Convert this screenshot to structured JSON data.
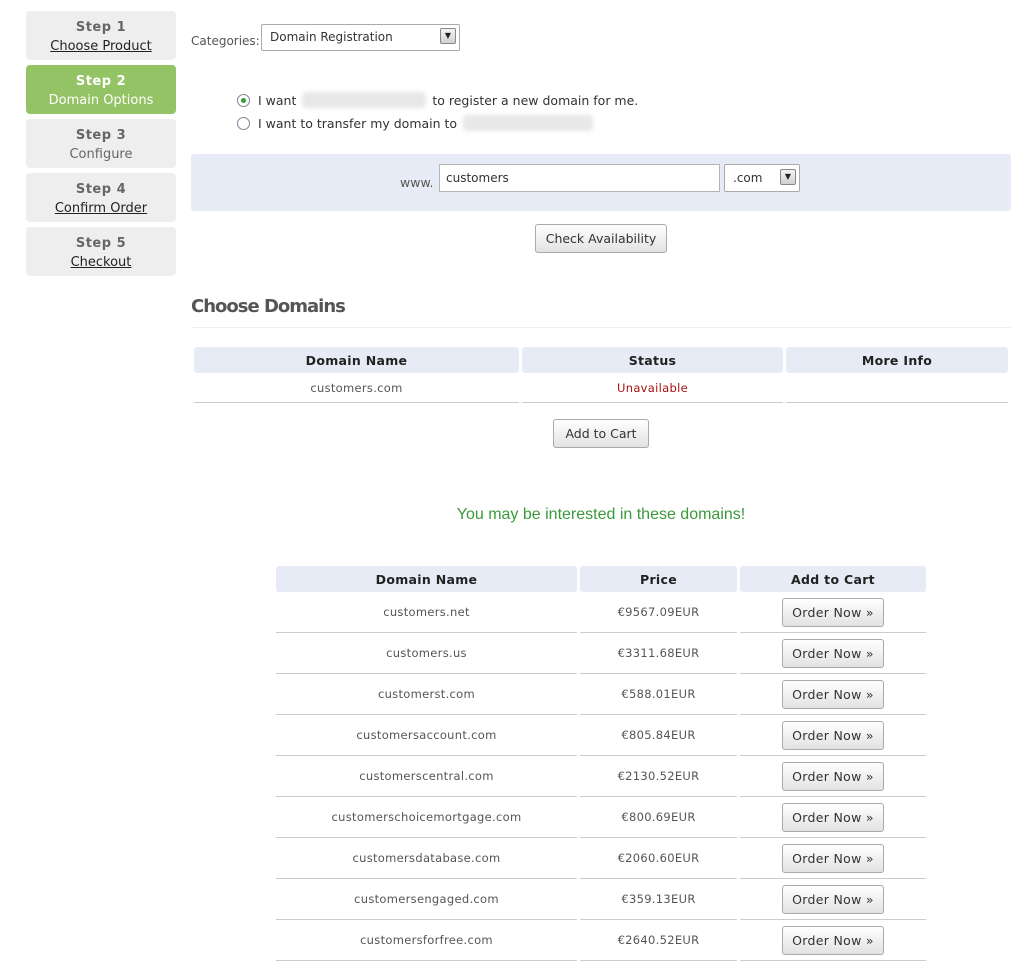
{
  "steps": [
    {
      "num": "Step 1",
      "label": "Choose Product"
    },
    {
      "num": "Step 2",
      "label": "Domain Options"
    },
    {
      "num": "Step 3",
      "label": "Configure"
    },
    {
      "num": "Step 4",
      "label": "Confirm Order"
    },
    {
      "num": "Step 5",
      "label": "Checkout"
    }
  ],
  "categories": {
    "label": "Categories:",
    "selected": "Domain Registration"
  },
  "options": {
    "register_prefix": "I want",
    "register_suffix": "to register a new domain for me.",
    "transfer_text": "I want to transfer my domain to"
  },
  "search": {
    "prefix": "www.",
    "value": "customers",
    "tld": ".com",
    "button": "Check Availability"
  },
  "choose": {
    "title": "Choose Domains",
    "headers": [
      "Domain Name",
      "Status",
      "More Info"
    ],
    "rows": [
      {
        "domain": "customers.com",
        "status": "Unavailable",
        "info": ""
      }
    ],
    "add_button": "Add to Cart"
  },
  "suggest": {
    "title": "You may be interested in these domains!",
    "headers": [
      "Domain Name",
      "Price",
      "Add to Cart"
    ],
    "order_label": "Order Now »",
    "rows": [
      {
        "domain": "customers.net",
        "price": "€9567.09EUR"
      },
      {
        "domain": "customers.us",
        "price": "€3311.68EUR"
      },
      {
        "domain": "customerst.com",
        "price": "€588.01EUR"
      },
      {
        "domain": "customersaccount.com",
        "price": "€805.84EUR"
      },
      {
        "domain": "customerscentral.com",
        "price": "€2130.52EUR"
      },
      {
        "domain": "customerschoicemortgage.com",
        "price": "€800.69EUR"
      },
      {
        "domain": "customersdatabase.com",
        "price": "€2060.60EUR"
      },
      {
        "domain": "customersengaged.com",
        "price": "€359.13EUR"
      },
      {
        "domain": "customersforfree.com",
        "price": "€2640.52EUR"
      }
    ]
  },
  "colors": {
    "accent_green": "#93c364",
    "header_blue": "#e6ebf5",
    "unavailable_red": "#aa1111",
    "interest_green": "#3a9a3a"
  }
}
